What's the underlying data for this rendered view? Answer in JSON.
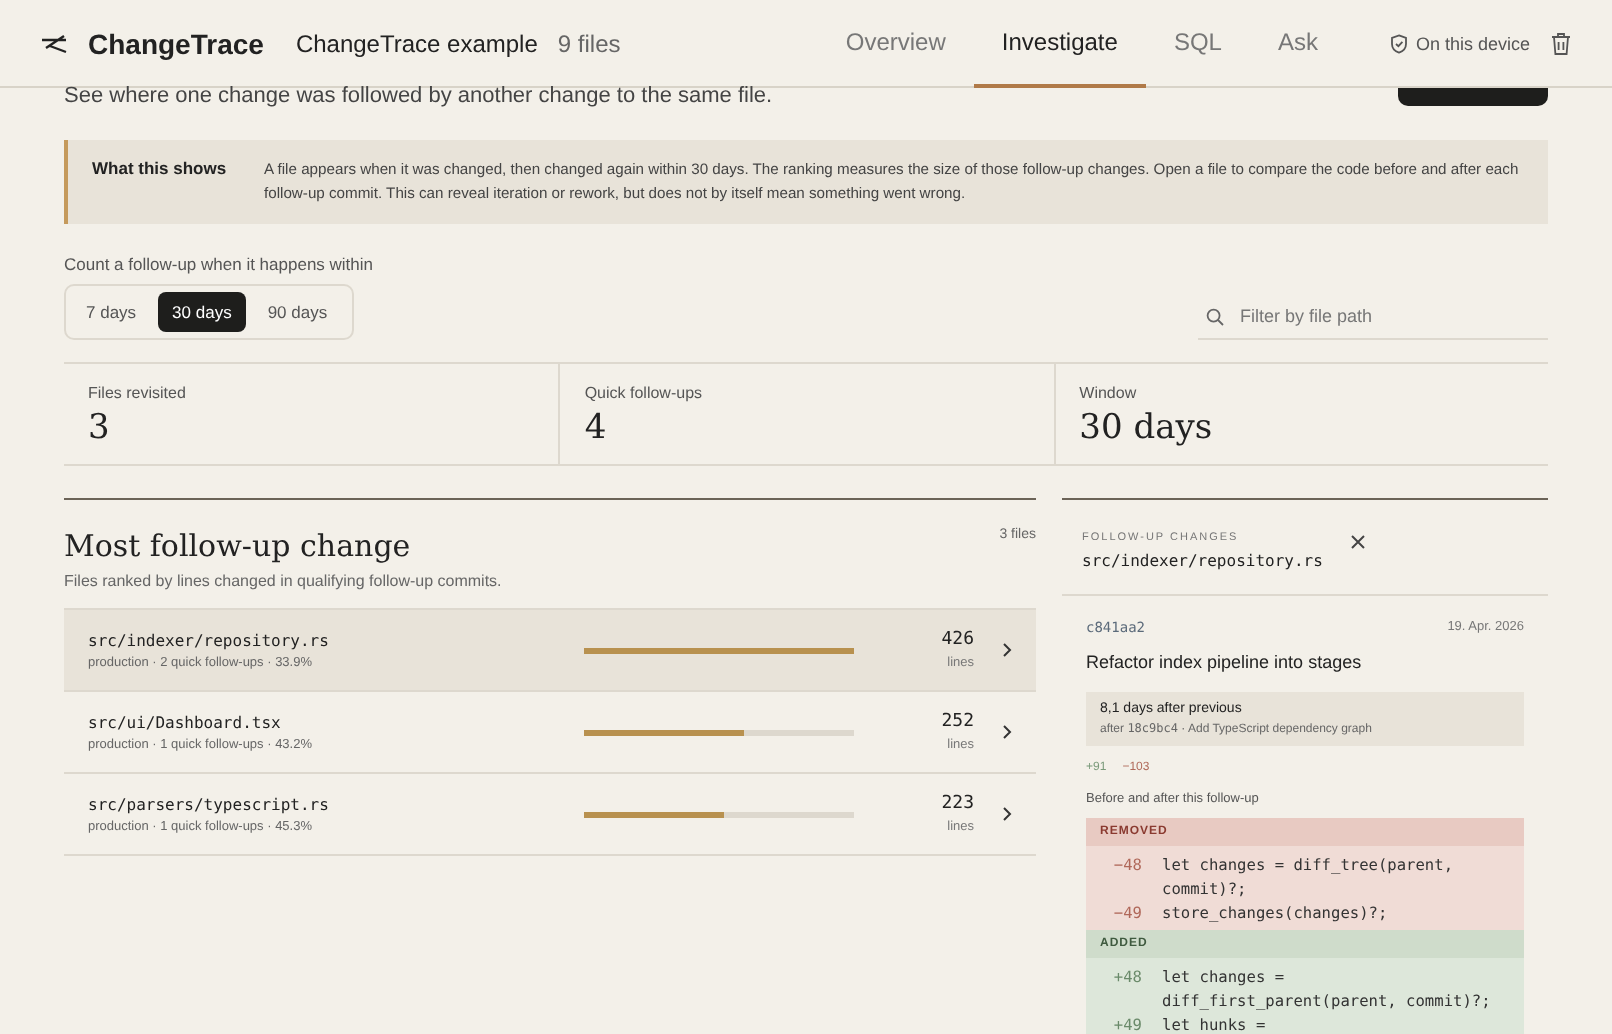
{
  "header": {
    "brand": "ChangeTrace",
    "project": "ChangeTrace example",
    "file_count": "9 files",
    "nav": [
      {
        "label": "Overview",
        "selected": false
      },
      {
        "label": "Investigate",
        "selected": true
      },
      {
        "label": "SQL",
        "selected": false
      },
      {
        "label": "Ask",
        "selected": false
      }
    ],
    "device": "On this device"
  },
  "subtitle": "See where one change was followed by another change to the same file.",
  "note": {
    "title": "What this shows",
    "text": "A file appears when it was changed, then changed again within 30 days. The ranking measures the size of those follow-up changes. Open a file to compare the code before and after each follow-up commit. This can reveal iteration or rework, but does not by itself mean something went wrong."
  },
  "window_picker": {
    "label": "Count a follow-up when it happens within",
    "options": [
      {
        "label": "7 days",
        "selected": false
      },
      {
        "label": "30 days",
        "selected": true
      },
      {
        "label": "90 days",
        "selected": false
      }
    ]
  },
  "search": {
    "placeholder": "Filter by file path"
  },
  "stats": [
    {
      "label": "Files revisited",
      "value": "3"
    },
    {
      "label": "Quick follow-ups",
      "value": "4"
    },
    {
      "label": "Window",
      "value": "30 days"
    }
  ],
  "ranking": {
    "title": "Most follow-up change",
    "subtitle": "Files ranked by lines changed in qualifying follow-up commits.",
    "count": "3 files",
    "rows": [
      {
        "path": "src/indexer/repository.rs",
        "meta": "production · 2 quick follow-ups · 33.9%",
        "level": 1.0,
        "lines": "426",
        "unit": "lines",
        "selected": true
      },
      {
        "path": "src/ui/Dashboard.tsx",
        "meta": "production · 1 quick follow-ups · 43.2%",
        "level": 0.59,
        "lines": "252",
        "unit": "lines",
        "selected": false
      },
      {
        "path": "src/parsers/typescript.rs",
        "meta": "production · 1 quick follow-ups · 45.3%",
        "level": 0.52,
        "lines": "223",
        "unit": "lines",
        "selected": false
      }
    ]
  },
  "detail": {
    "eyebrow": "FOLLOW-UP CHANGES",
    "path": "src/indexer/repository.rs",
    "commit": {
      "hash": "c841aa2",
      "date": "19. Apr. 2026",
      "title": "Refactor index pipeline into stages",
      "gap": "8,1 days after previous",
      "after_label": "after",
      "after_hash": "18c9bc4",
      "after_text": "· Add TypeScript dependency graph",
      "added": "+91",
      "removed": "−103"
    },
    "diff_label": "Before and after this follow-up",
    "diff": [
      {
        "kind": "removed",
        "heading": "REMOVED",
        "lines": [
          {
            "number": "−48",
            "code": "let changes = diff_tree(parent, commit)?;"
          },
          {
            "number": "−49",
            "code": "store_changes(changes)?;"
          }
        ]
      },
      {
        "kind": "added",
        "heading": "ADDED",
        "lines": [
          {
            "number": "+48",
            "code": "let changes = diff_first_parent(parent, commit)?;"
          },
          {
            "number": "+49",
            "code": "let hunks ="
          }
        ]
      }
    ]
  }
}
